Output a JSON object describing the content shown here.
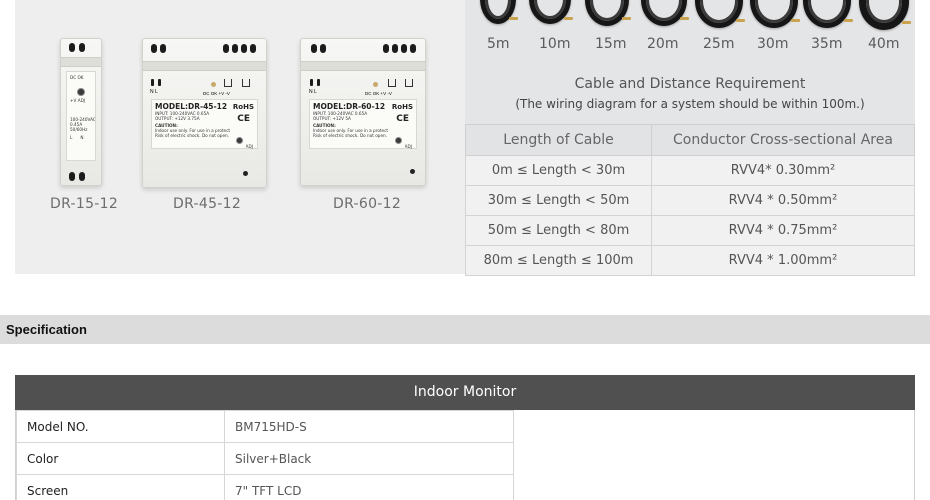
{
  "products": [
    {
      "name": "DR-15-12",
      "model": "",
      "fine": [
        "100-240VAC",
        "0.45A",
        "50/60Hz"
      ],
      "adj": "+V ADJ",
      "dcok": "DC OK",
      "terminals_top": "",
      "terminals_bottom": [
        "L",
        "N"
      ]
    },
    {
      "name": "DR-45-12",
      "model": "MODEL:DR-45-12",
      "fine": [
        "INPUT: 100-240VAC  0.65A",
        "OUTPUT: +12V  3.75A",
        "CAUTION:",
        "Indoor use only. For use in a protected environment only.",
        "Risk of electric shock. Do not open."
      ],
      "rohs": "RoHS",
      "ce": "CE",
      "adj": "ADJ",
      "dcok": "DC OK  +V   -V",
      "terminals_top": "N  L"
    },
    {
      "name": "DR-60-12",
      "model": "MODEL:DR-60-12",
      "fine": [
        "INPUT: 100-240VAC  0.65A",
        "OUTPUT: +12V  5A",
        "CAUTION:",
        "Indoor use only. For use in a protected environment only.",
        "Risk of electric shock. Do not open."
      ],
      "rohs": "RoHS",
      "ce": "CE",
      "adj": "ADJ",
      "dcok": "DC OK  +V   -V",
      "terminals_top": "N  L"
    }
  ],
  "cable_lengths": [
    "5m",
    "10m",
    "15m",
    "20m",
    "25m",
    "30m",
    "35m",
    "40m"
  ],
  "requirement": {
    "title": "Cable and Distance Requirement",
    "subtitle": "(The wiring diagram for a system should be within 100m.)",
    "headers": [
      "Length of Cable",
      "Conductor Cross-sectional Area"
    ],
    "rows": [
      [
        "0m ≤ Length < 30m",
        "RVV4* 0.30mm²"
      ],
      [
        "30m ≤ Length < 50m",
        "RVV4 * 0.50mm²"
      ],
      [
        "50m ≤ Length < 80m",
        "RVV4 * 0.75mm²"
      ],
      [
        "80m ≤ Length ≤ 100m",
        "RVV4 * 1.00mm²"
      ]
    ]
  },
  "specification": {
    "title": "Specification"
  },
  "monitor": {
    "title": "Indoor Monitor",
    "rows": [
      [
        "Model NO.",
        "BM715HD-S"
      ],
      [
        "Color",
        "Silver+Black"
      ],
      [
        "Screen",
        "7\" TFT LCD"
      ]
    ]
  },
  "colors": {
    "header_bg": "#505050",
    "spec_bar_bg": "#dcdcdc",
    "table_bg": "#f1f1f1"
  }
}
